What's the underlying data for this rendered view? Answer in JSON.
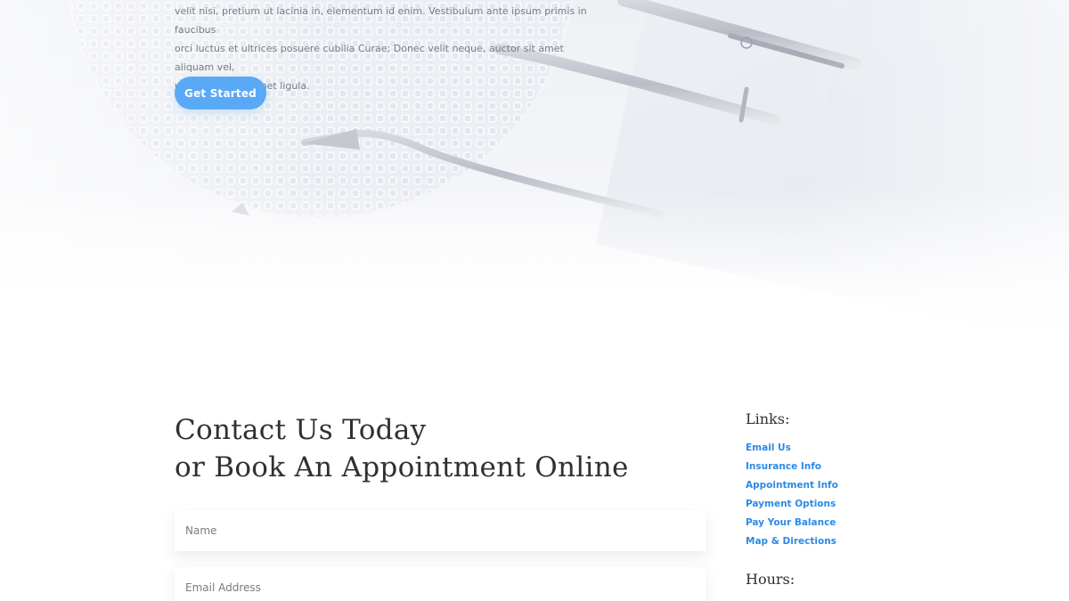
{
  "hero": {
    "body_lines": [
      "velit nisi, pretium ut lacinia in, elementum id enim. Vestibulum ante ipsum primis in faucibus",
      "orci luctus et ultrices posuere cubilia Curae; Donec velit neque, auctor sit amet aliquam vel,",
      "ullamcorper sit amet ligula."
    ],
    "cta_label": "Get Started"
  },
  "contact": {
    "title_line1": "Contact Us Today",
    "title_line2": "or Book An Appointment Online",
    "name_placeholder": "Name",
    "email_placeholder": "Email Address"
  },
  "sidebar": {
    "links_heading": "Links:",
    "links": [
      {
        "label": "Email Us"
      },
      {
        "label": "Insurance Info"
      },
      {
        "label": "Appointment Info"
      },
      {
        "label": "Payment Options"
      },
      {
        "label": "Pay Your Balance"
      },
      {
        "label": "Map & Directions"
      }
    ],
    "hours_heading": "Hours:"
  },
  "colors": {
    "accent": "#5aa9f6",
    "link": "#2c8ae6",
    "heading": "#2f2f35"
  }
}
